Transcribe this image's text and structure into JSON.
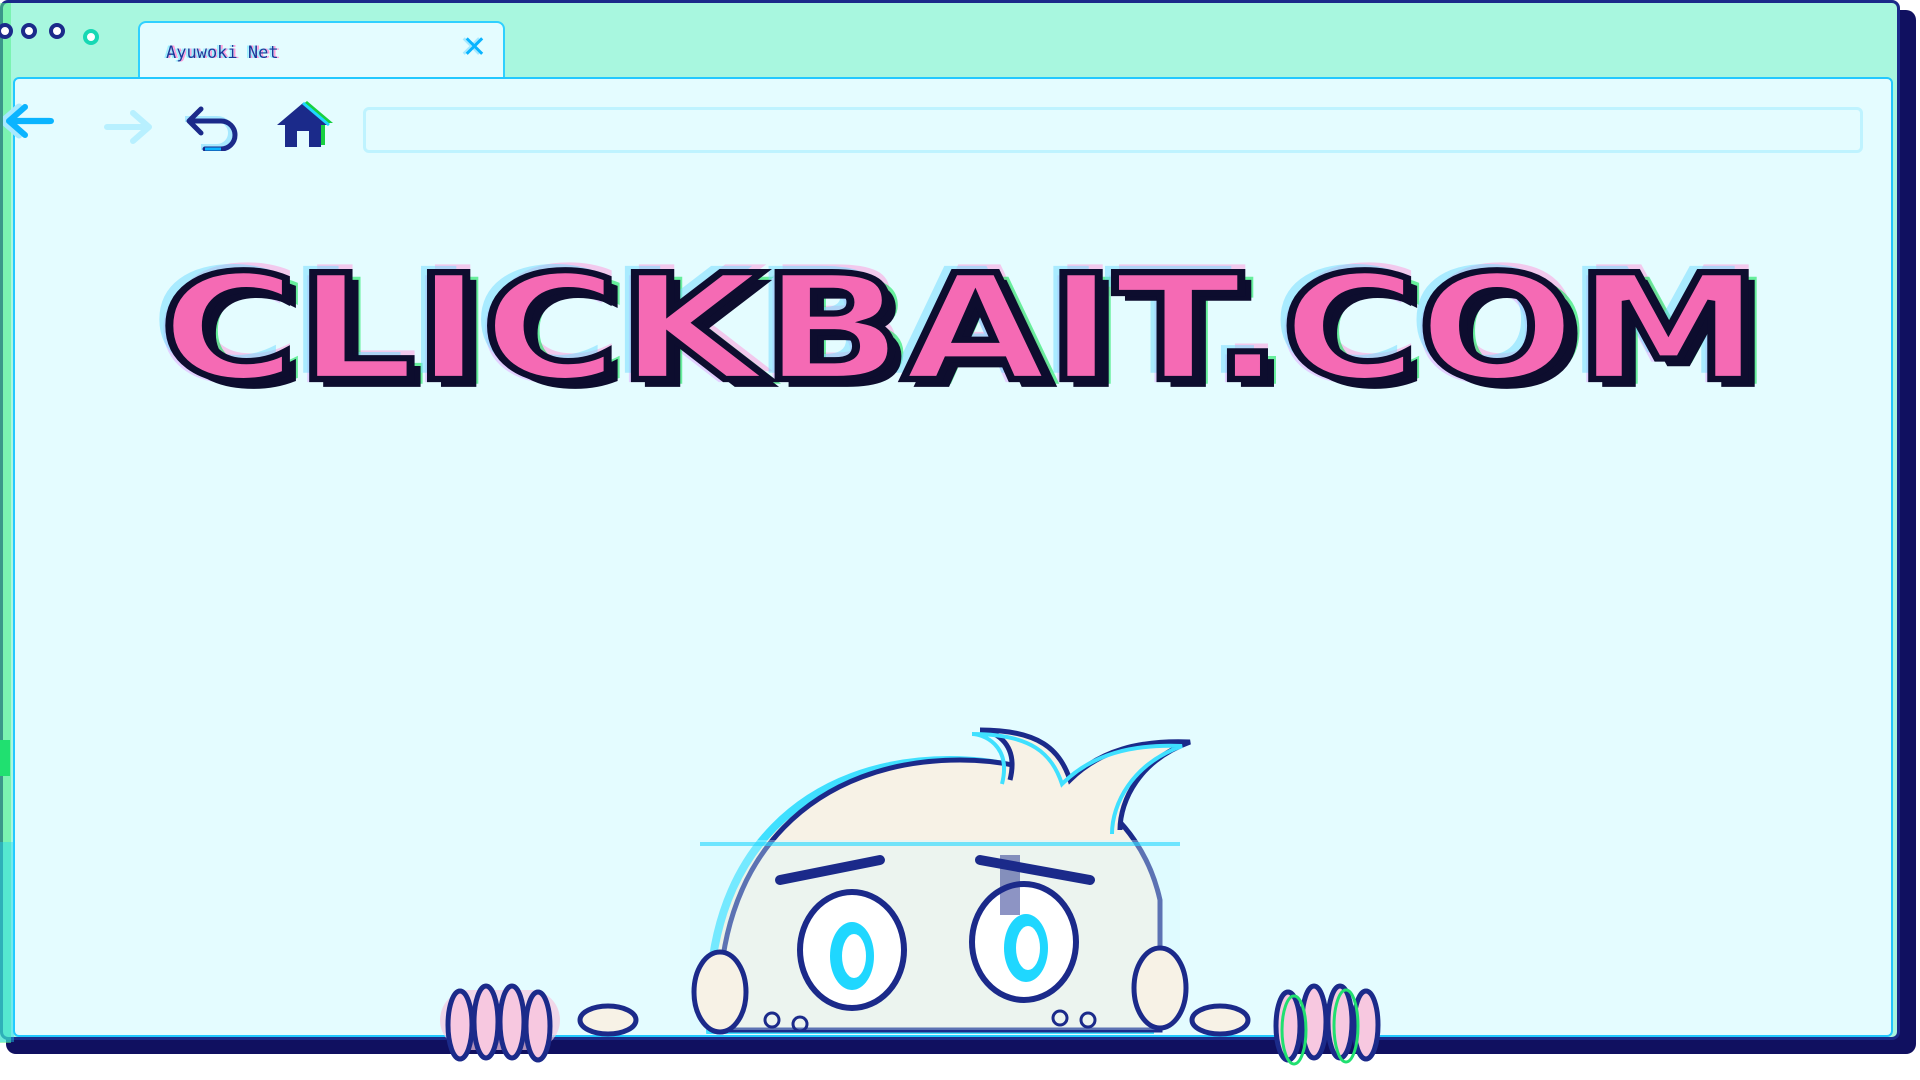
{
  "window": {
    "tab_title": "Ayuwoki Net",
    "tab_close_icon": "close-icon"
  },
  "toolbar": {
    "back_icon": "arrow-left-icon",
    "forward_icon": "arrow-right-icon",
    "refresh_icon": "undo-icon",
    "home_icon": "home-icon",
    "address_value": ""
  },
  "content": {
    "headline": "CLICKBAIT.COM",
    "illustration": "peeking-cartoon-character"
  },
  "colors": {
    "frame": "#a8f7df",
    "page_bg": "#e4fcff",
    "accent_blue": "#1b2a8a",
    "accent_cyan": "#22c8ff",
    "headline_pink": "#f56ab4",
    "glitch_green": "#20e070"
  }
}
